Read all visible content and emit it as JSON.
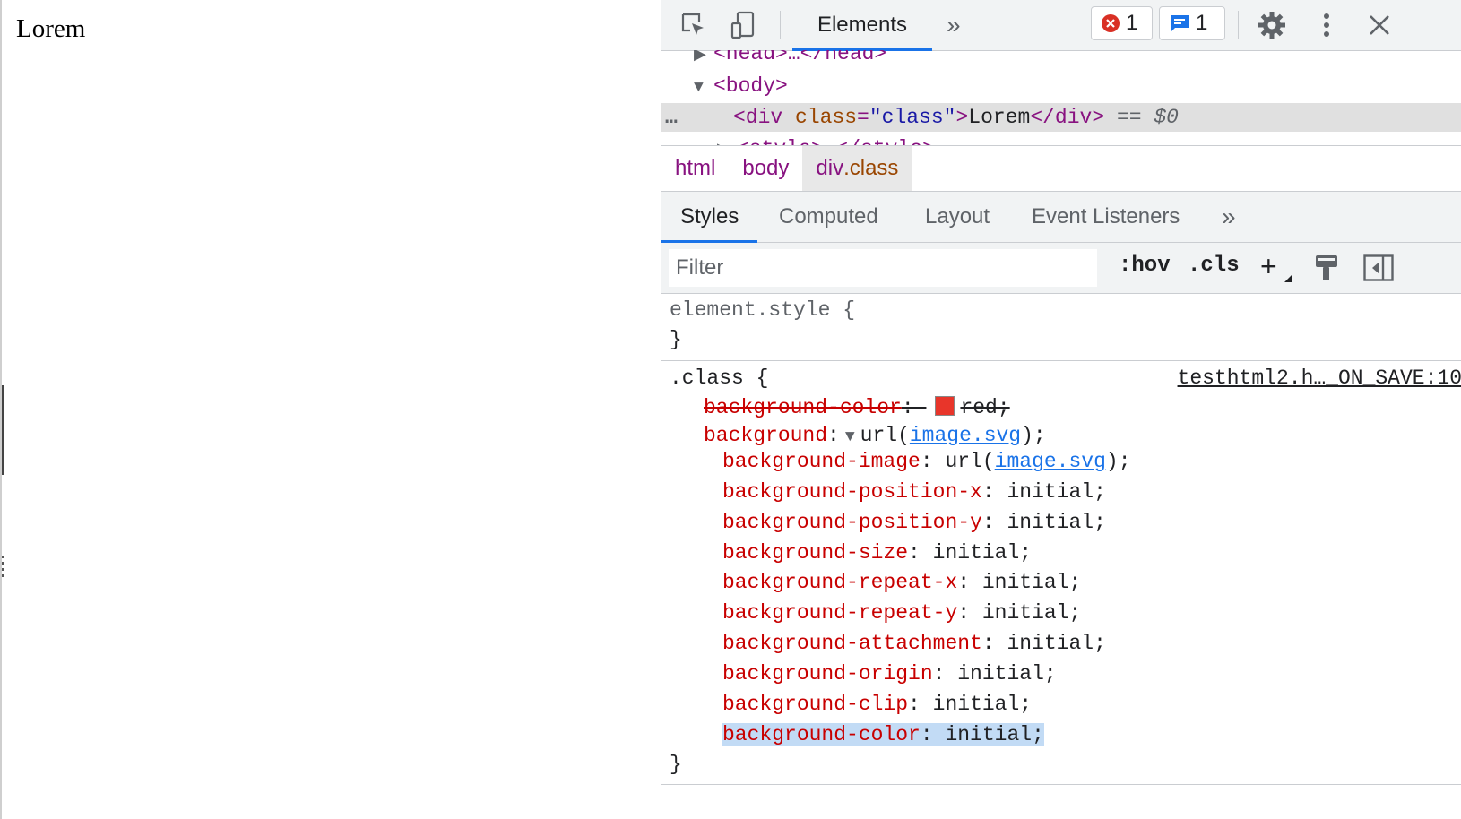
{
  "page": {
    "text": "Lorem"
  },
  "toolbar": {
    "tab_elements": "Elements",
    "more_tabs": "»",
    "errors_count": "1",
    "messages_count": "1",
    "colors": {
      "accent": "#1a73e8",
      "error": "#d93025"
    }
  },
  "dom": {
    "head_line": "<head>…</head>",
    "body_open": "<body>",
    "div_open_tag": "<div",
    "div_attr_name": "class",
    "div_attr_value": "\"class\"",
    "div_text": "Lorem",
    "div_close": "</div>",
    "selected_marker": "== $0",
    "style_line": "<style>…</style>",
    "dots": "…"
  },
  "breadcrumbs": {
    "html": "html",
    "body": "body",
    "div_tag": "div",
    "div_class": ".class"
  },
  "subtabs": {
    "styles": "Styles",
    "computed": "Computed",
    "layout": "Layout",
    "event_listeners": "Event Listeners",
    "more": "»"
  },
  "filter": {
    "placeholder": "Filter",
    "hov": ":hov",
    "cls": ".cls",
    "add": "+"
  },
  "styles": {
    "element_style_selector": "element.style {",
    "close_brace": "}",
    "class_selector": ".class {",
    "source": "testhtml2.h…_ON_SAVE:10",
    "overridden": {
      "name": "background-color",
      "value": "red;"
    },
    "shorthand": {
      "name": "background",
      "url_fn": "url(",
      "url": "image.svg",
      "end": ");"
    },
    "longhands": [
      {
        "name": "background-image",
        "prefix": "url(",
        "link": "image.svg",
        "suffix": ");"
      },
      {
        "name": "background-position-x",
        "value": "initial;"
      },
      {
        "name": "background-position-y",
        "value": "initial;"
      },
      {
        "name": "background-size",
        "value": "initial;"
      },
      {
        "name": "background-repeat-x",
        "value": "initial;"
      },
      {
        "name": "background-repeat-y",
        "value": "initial;"
      },
      {
        "name": "background-attachment",
        "value": "initial;"
      },
      {
        "name": "background-origin",
        "value": "initial;"
      },
      {
        "name": "background-clip",
        "value": "initial;"
      },
      {
        "name": "background-color",
        "value": "initial;"
      }
    ]
  }
}
